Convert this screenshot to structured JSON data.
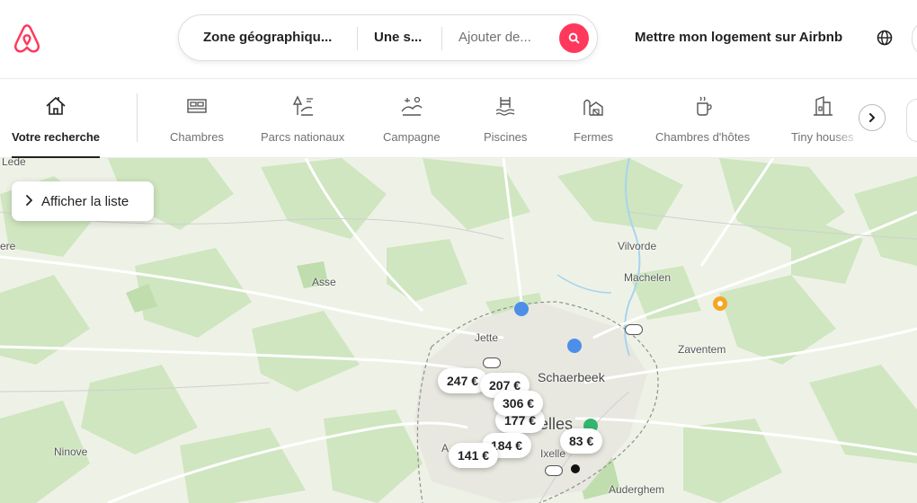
{
  "header": {
    "logo_icon": "airbnb-logo-icon",
    "search": {
      "location": "Zone géographiqu...",
      "dates": "Une s...",
      "guests_placeholder": "Ajouter de...",
      "button_icon": "search-icon"
    },
    "host_link": "Mettre mon logement sur Airbnb",
    "globe_icon": "globe-icon",
    "accent_color": "#ff385c"
  },
  "categories": {
    "items": [
      {
        "label": "Votre recherche",
        "icon": "home-search-icon",
        "active": true
      },
      {
        "label": "Chambres",
        "icon": "bed-icon"
      },
      {
        "label": "Parcs nationaux",
        "icon": "national-park-icon"
      },
      {
        "label": "Campagne",
        "icon": "countryside-icon"
      },
      {
        "label": "Piscines",
        "icon": "pool-icon"
      },
      {
        "label": "Fermes",
        "icon": "farm-icon"
      },
      {
        "label": "Chambres d'hôtes",
        "icon": "coffee-cup-icon"
      },
      {
        "label": "Tiny houses",
        "icon": "tiny-house-icon"
      }
    ],
    "next_icon": "chevron-right-icon"
  },
  "map": {
    "list_button": "Afficher la liste",
    "list_button_icon": "chevron-right-icon",
    "places": {
      "lede": "Lede",
      "ere": "ere",
      "vilvorde": "Vilvorde",
      "machelen": "Machelen",
      "asse": "Asse",
      "jette": "Jette",
      "zaventem": "Zaventem",
      "schaerbeek": "Schaerbeek",
      "bruxelles": "elles",
      "ninove": "Ninove",
      "ixelles": "Ixelle",
      "auderghem": "Auderghem",
      "a": "A"
    },
    "price_pins": [
      "247 €",
      "207 €",
      "306 €",
      "177 €",
      "83 €",
      "184 €",
      "141 €"
    ]
  }
}
